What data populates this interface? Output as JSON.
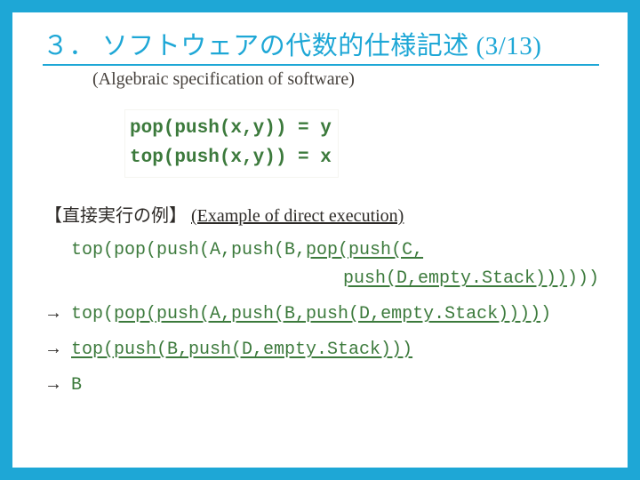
{
  "title": {
    "num": "３．",
    "jp": "ソフトウェアの代数的仕様記述",
    "page": "(3/13)"
  },
  "subtitle": "(Algebraic specification of software)",
  "spec": {
    "line1": "pop(push(x,y)) = y",
    "line2": "top(push(x,y)) = x"
  },
  "example_header": {
    "jp": "【直接実行の例】",
    "en": "(Example of direct execution)"
  },
  "exec": {
    "l0a_pre": "top(pop(push(A,push(B,",
    "l0a_u": "pop(push(C,",
    "l0b_u": "push(D,empty.Stack)))",
    "l0b_post": ")))",
    "arrow": "→",
    "l1_pre": "top(",
    "l1_u": "pop(push(A,push(B,push(D,empty.Stack))))",
    "l1_post": ")",
    "l2_pre": "",
    "l2_u": "top(push(B,push(D,empty.Stack)))",
    "l2_post": "",
    "l3": "B"
  }
}
